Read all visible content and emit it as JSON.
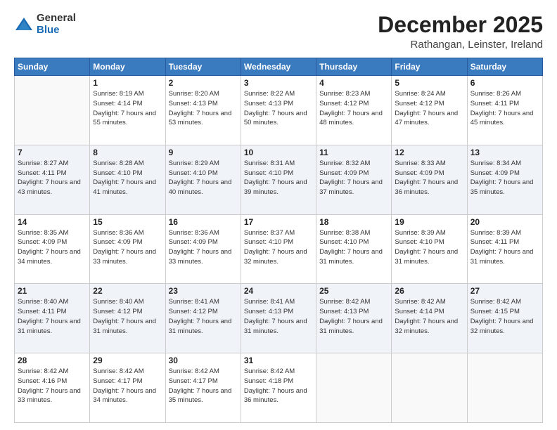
{
  "header": {
    "logo_general": "General",
    "logo_blue": "Blue",
    "month_title": "December 2025",
    "location": "Rathangan, Leinster, Ireland"
  },
  "weekdays": [
    "Sunday",
    "Monday",
    "Tuesday",
    "Wednesday",
    "Thursday",
    "Friday",
    "Saturday"
  ],
  "weeks": [
    [
      {
        "day": "",
        "sunrise": "",
        "sunset": "",
        "daylight": "",
        "empty": true
      },
      {
        "day": "1",
        "sunrise": "Sunrise: 8:19 AM",
        "sunset": "Sunset: 4:14 PM",
        "daylight": "Daylight: 7 hours and 55 minutes."
      },
      {
        "day": "2",
        "sunrise": "Sunrise: 8:20 AM",
        "sunset": "Sunset: 4:13 PM",
        "daylight": "Daylight: 7 hours and 53 minutes."
      },
      {
        "day": "3",
        "sunrise": "Sunrise: 8:22 AM",
        "sunset": "Sunset: 4:13 PM",
        "daylight": "Daylight: 7 hours and 50 minutes."
      },
      {
        "day": "4",
        "sunrise": "Sunrise: 8:23 AM",
        "sunset": "Sunset: 4:12 PM",
        "daylight": "Daylight: 7 hours and 48 minutes."
      },
      {
        "day": "5",
        "sunrise": "Sunrise: 8:24 AM",
        "sunset": "Sunset: 4:12 PM",
        "daylight": "Daylight: 7 hours and 47 minutes."
      },
      {
        "day": "6",
        "sunrise": "Sunrise: 8:26 AM",
        "sunset": "Sunset: 4:11 PM",
        "daylight": "Daylight: 7 hours and 45 minutes."
      }
    ],
    [
      {
        "day": "7",
        "sunrise": "Sunrise: 8:27 AM",
        "sunset": "Sunset: 4:11 PM",
        "daylight": "Daylight: 7 hours and 43 minutes."
      },
      {
        "day": "8",
        "sunrise": "Sunrise: 8:28 AM",
        "sunset": "Sunset: 4:10 PM",
        "daylight": "Daylight: 7 hours and 41 minutes."
      },
      {
        "day": "9",
        "sunrise": "Sunrise: 8:29 AM",
        "sunset": "Sunset: 4:10 PM",
        "daylight": "Daylight: 7 hours and 40 minutes."
      },
      {
        "day": "10",
        "sunrise": "Sunrise: 8:31 AM",
        "sunset": "Sunset: 4:10 PM",
        "daylight": "Daylight: 7 hours and 39 minutes."
      },
      {
        "day": "11",
        "sunrise": "Sunrise: 8:32 AM",
        "sunset": "Sunset: 4:09 PM",
        "daylight": "Daylight: 7 hours and 37 minutes."
      },
      {
        "day": "12",
        "sunrise": "Sunrise: 8:33 AM",
        "sunset": "Sunset: 4:09 PM",
        "daylight": "Daylight: 7 hours and 36 minutes."
      },
      {
        "day": "13",
        "sunrise": "Sunrise: 8:34 AM",
        "sunset": "Sunset: 4:09 PM",
        "daylight": "Daylight: 7 hours and 35 minutes."
      }
    ],
    [
      {
        "day": "14",
        "sunrise": "Sunrise: 8:35 AM",
        "sunset": "Sunset: 4:09 PM",
        "daylight": "Daylight: 7 hours and 34 minutes."
      },
      {
        "day": "15",
        "sunrise": "Sunrise: 8:36 AM",
        "sunset": "Sunset: 4:09 PM",
        "daylight": "Daylight: 7 hours and 33 minutes."
      },
      {
        "day": "16",
        "sunrise": "Sunrise: 8:36 AM",
        "sunset": "Sunset: 4:09 PM",
        "daylight": "Daylight: 7 hours and 33 minutes."
      },
      {
        "day": "17",
        "sunrise": "Sunrise: 8:37 AM",
        "sunset": "Sunset: 4:10 PM",
        "daylight": "Daylight: 7 hours and 32 minutes."
      },
      {
        "day": "18",
        "sunrise": "Sunrise: 8:38 AM",
        "sunset": "Sunset: 4:10 PM",
        "daylight": "Daylight: 7 hours and 31 minutes."
      },
      {
        "day": "19",
        "sunrise": "Sunrise: 8:39 AM",
        "sunset": "Sunset: 4:10 PM",
        "daylight": "Daylight: 7 hours and 31 minutes."
      },
      {
        "day": "20",
        "sunrise": "Sunrise: 8:39 AM",
        "sunset": "Sunset: 4:11 PM",
        "daylight": "Daylight: 7 hours and 31 minutes."
      }
    ],
    [
      {
        "day": "21",
        "sunrise": "Sunrise: 8:40 AM",
        "sunset": "Sunset: 4:11 PM",
        "daylight": "Daylight: 7 hours and 31 minutes."
      },
      {
        "day": "22",
        "sunrise": "Sunrise: 8:40 AM",
        "sunset": "Sunset: 4:12 PM",
        "daylight": "Daylight: 7 hours and 31 minutes."
      },
      {
        "day": "23",
        "sunrise": "Sunrise: 8:41 AM",
        "sunset": "Sunset: 4:12 PM",
        "daylight": "Daylight: 7 hours and 31 minutes."
      },
      {
        "day": "24",
        "sunrise": "Sunrise: 8:41 AM",
        "sunset": "Sunset: 4:13 PM",
        "daylight": "Daylight: 7 hours and 31 minutes."
      },
      {
        "day": "25",
        "sunrise": "Sunrise: 8:42 AM",
        "sunset": "Sunset: 4:13 PM",
        "daylight": "Daylight: 7 hours and 31 minutes."
      },
      {
        "day": "26",
        "sunrise": "Sunrise: 8:42 AM",
        "sunset": "Sunset: 4:14 PM",
        "daylight": "Daylight: 7 hours and 32 minutes."
      },
      {
        "day": "27",
        "sunrise": "Sunrise: 8:42 AM",
        "sunset": "Sunset: 4:15 PM",
        "daylight": "Daylight: 7 hours and 32 minutes."
      }
    ],
    [
      {
        "day": "28",
        "sunrise": "Sunrise: 8:42 AM",
        "sunset": "Sunset: 4:16 PM",
        "daylight": "Daylight: 7 hours and 33 minutes."
      },
      {
        "day": "29",
        "sunrise": "Sunrise: 8:42 AM",
        "sunset": "Sunset: 4:17 PM",
        "daylight": "Daylight: 7 hours and 34 minutes."
      },
      {
        "day": "30",
        "sunrise": "Sunrise: 8:42 AM",
        "sunset": "Sunset: 4:17 PM",
        "daylight": "Daylight: 7 hours and 35 minutes."
      },
      {
        "day": "31",
        "sunrise": "Sunrise: 8:42 AM",
        "sunset": "Sunset: 4:18 PM",
        "daylight": "Daylight: 7 hours and 36 minutes."
      },
      {
        "day": "",
        "sunrise": "",
        "sunset": "",
        "daylight": "",
        "empty": true
      },
      {
        "day": "",
        "sunrise": "",
        "sunset": "",
        "daylight": "",
        "empty": true
      },
      {
        "day": "",
        "sunrise": "",
        "sunset": "",
        "daylight": "",
        "empty": true
      }
    ]
  ]
}
